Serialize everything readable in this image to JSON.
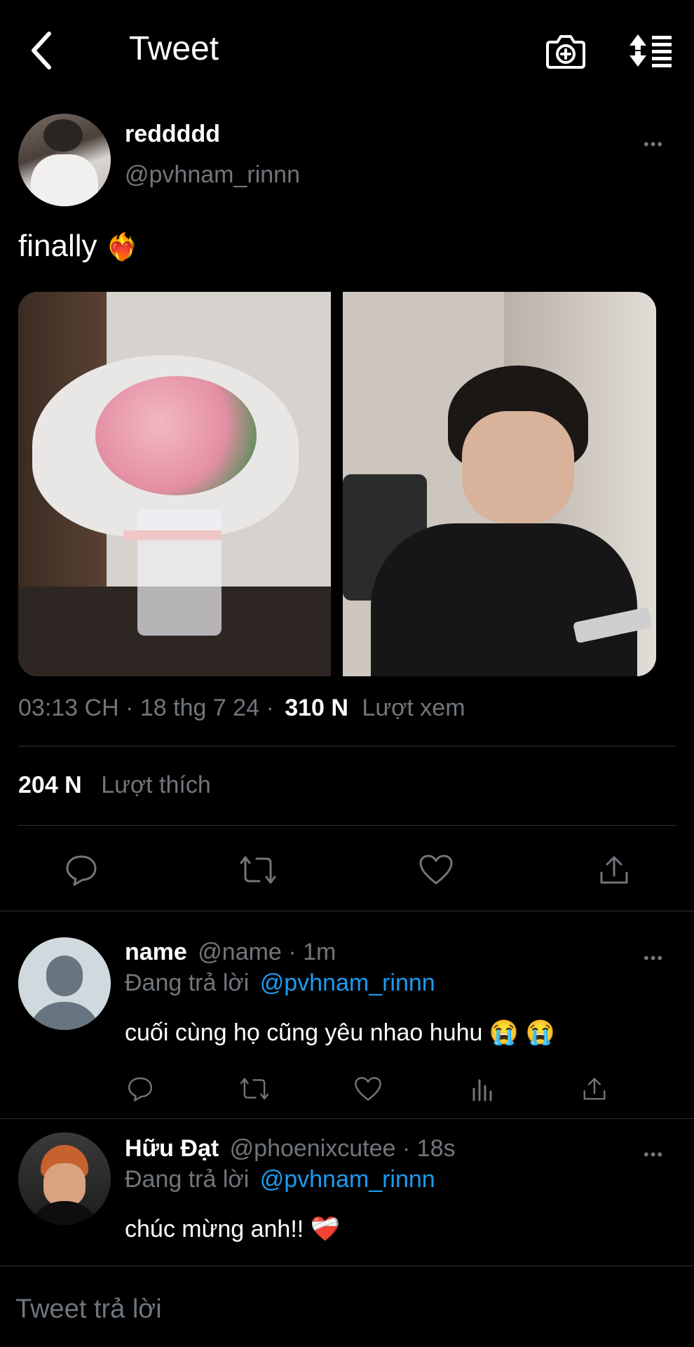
{
  "header": {
    "title": "Tweet",
    "back_icon": "chevron-left-icon",
    "camera_icon": "camera-plus-icon",
    "sort_icon": "sort-lines-icon"
  },
  "tweet": {
    "display_name": "reddddd",
    "handle": "@pvhnam_rinnn",
    "text": "finally",
    "emoji": "❤️‍🔥",
    "timestamp": "03:13 CH · 18 thg 7 24 ·",
    "views_count": "310 N",
    "views_label": "Lượt xem",
    "likes_count": "204 N",
    "likes_label": "Lượt thích",
    "more": "•••"
  },
  "replies": [
    {
      "display_name": "name",
      "handle": "@name",
      "time": "· 1m",
      "replying_prefix": "Đang trả lời",
      "replying_to": "@pvhnam_rinnn",
      "text": "cuối cùng họ cũng yêu nhao huhu 😭 😭",
      "more": "•••"
    },
    {
      "display_name": "Hữu Đạt",
      "handle": "@phoenixcutee",
      "time": "· 18s",
      "replying_prefix": "Đang trả lời",
      "replying_to": "@pvhnam_rinnn",
      "text": "chúc mừng anh!! ❤️‍🩹",
      "more": "•••"
    }
  ],
  "reply_box": {
    "placeholder": "Tweet trả lời"
  },
  "colors": {
    "background": "#000000",
    "muted": "#71767b",
    "link": "#1d9bf0",
    "divider": "#2f3336"
  }
}
